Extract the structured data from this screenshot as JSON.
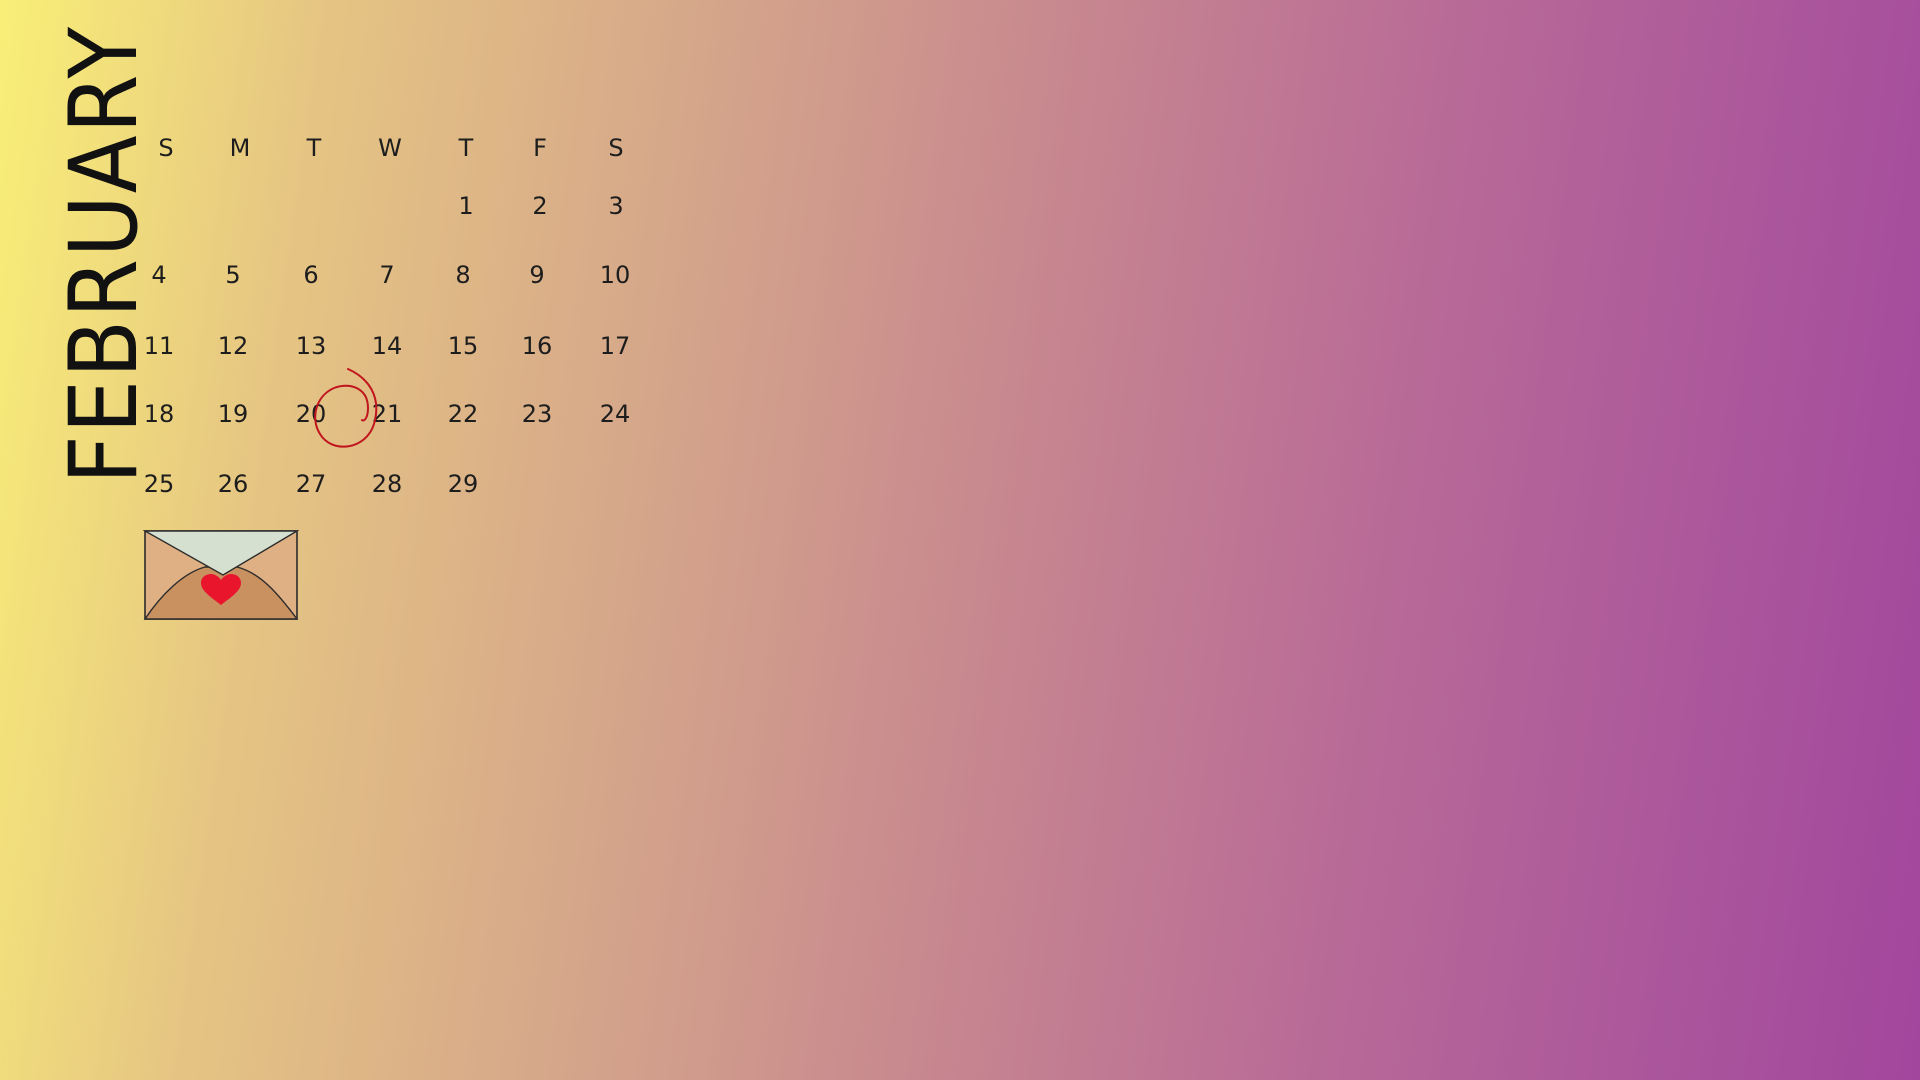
{
  "calendar": {
    "month": "FEBRUARY",
    "weekdays": [
      "S",
      "M",
      "T",
      "W",
      "T",
      "F",
      "S"
    ],
    "weeks": [
      [
        "",
        "",
        "",
        "",
        "1",
        "2",
        "3"
      ],
      [
        "4",
        "5",
        "6",
        "7",
        "8",
        "9",
        "10"
      ],
      [
        "11",
        "12",
        "13",
        "14",
        "15",
        "16",
        "17"
      ],
      [
        "18",
        "19",
        "20",
        "21",
        "22",
        "23",
        "24"
      ],
      [
        "25",
        "26",
        "27",
        "28",
        "29",
        "",
        ""
      ]
    ],
    "highlighted_day": "20",
    "highlight_color": "#c0151e"
  },
  "decorations": {
    "envelope": "envelope-with-heart-icon",
    "heart_color": "#e8152d"
  }
}
